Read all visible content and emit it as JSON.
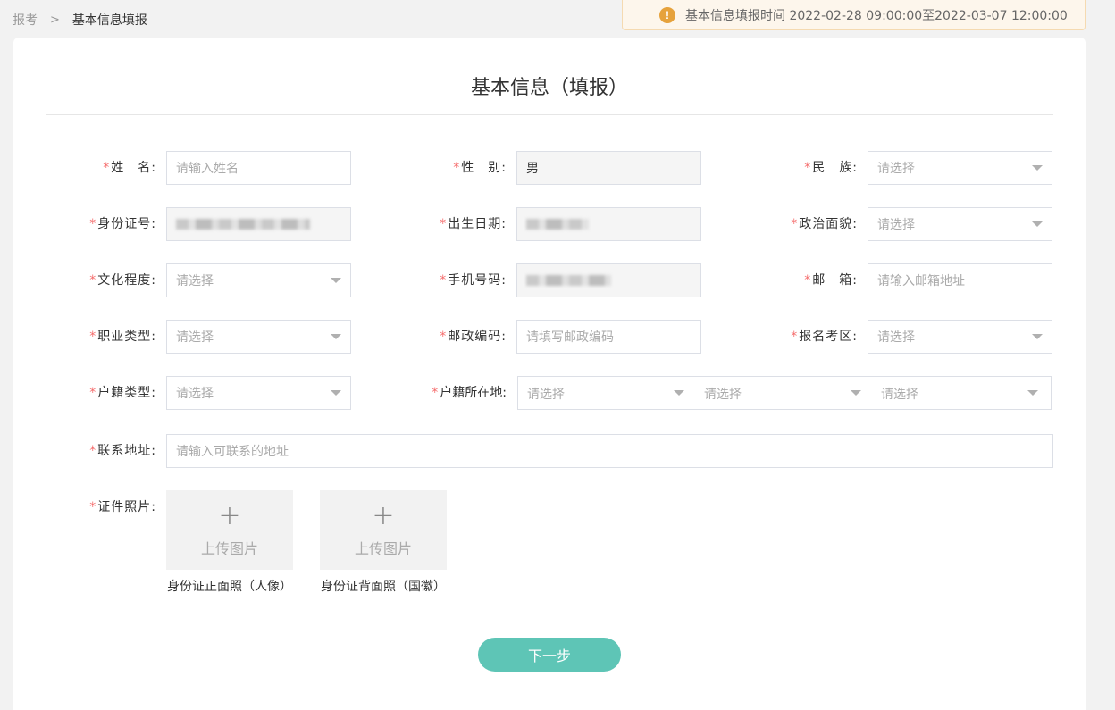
{
  "breadcrumb": {
    "parent": "报考",
    "separator": ">",
    "current": "基本信息填报"
  },
  "notice": {
    "icon": "!",
    "text": "基本信息填报时间 2022-02-28 09:00:00至2022-03-07 12:00:00"
  },
  "form": {
    "title": "基本信息（填报）",
    "required_mark": "*",
    "name": {
      "label": "姓　名:",
      "placeholder": "请输入姓名"
    },
    "gender": {
      "label": "性　别:",
      "value": "男"
    },
    "ethnicity": {
      "label": "民　族:",
      "placeholder": "请选择"
    },
    "id_number": {
      "label": "身份证号:"
    },
    "birth_date": {
      "label": "出生日期:"
    },
    "political_status": {
      "label": "政治面貌:",
      "placeholder": "请选择"
    },
    "education": {
      "label": "文化程度:",
      "placeholder": "请选择"
    },
    "phone": {
      "label": "手机号码:"
    },
    "email": {
      "label": "邮　箱:",
      "placeholder": "请输入邮箱地址"
    },
    "occupation": {
      "label": "职业类型:",
      "placeholder": "请选择"
    },
    "postal_code": {
      "label": "邮政编码:",
      "placeholder": "请填写邮政编码"
    },
    "exam_area": {
      "label": "报名考区:",
      "placeholder": "请选择"
    },
    "household_type": {
      "label": "户籍类型:",
      "placeholder": "请选择"
    },
    "household_location": {
      "label": "户籍所在地:",
      "province": "请选择",
      "city": "请选择",
      "district": "请选择"
    },
    "address": {
      "label": "联系地址:",
      "placeholder": "请输入可联系的地址"
    },
    "id_photos": {
      "label": "证件照片:",
      "upload_text": "上传图片",
      "front_caption": "身份证正面照（人像）",
      "back_caption": "身份证背面照（国徽）"
    },
    "next_button": "下一步"
  },
  "colors": {
    "accent": "#5ec5b6",
    "required": "#f56c6c",
    "warning": "#e6a23c"
  }
}
